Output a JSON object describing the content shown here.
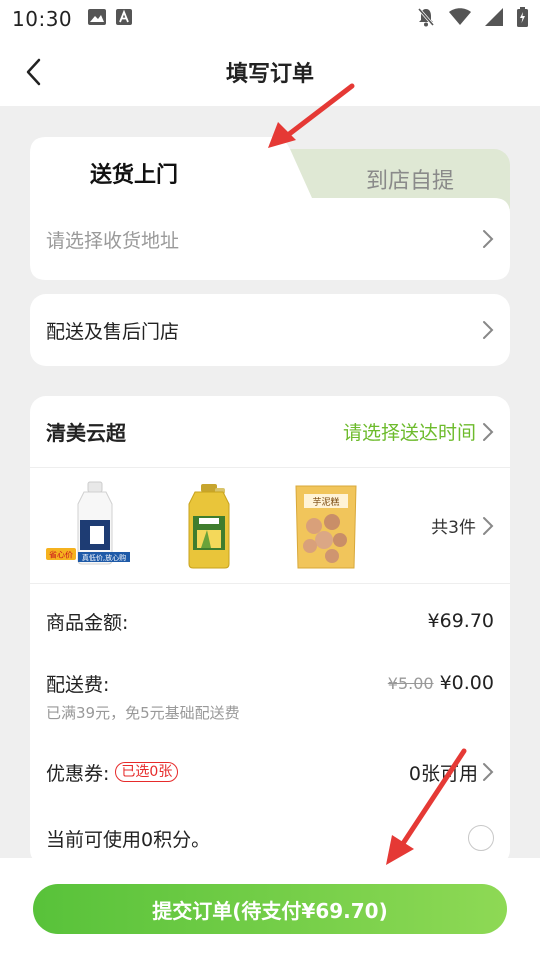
{
  "status_bar": {
    "time": "10:30",
    "left_icons": [
      "image-icon",
      "text-a-icon"
    ],
    "right_icons": [
      "notifications-off-icon",
      "wifi-icon",
      "signal-icon",
      "battery-icon"
    ]
  },
  "header": {
    "title": "填写订单",
    "back_icon": "chevron-left-icon"
  },
  "delivery_tabs": {
    "active": "送货上门",
    "inactive": "到店自提",
    "address_placeholder": "请选择收货地址"
  },
  "store_row": {
    "label": "配送及售后门店"
  },
  "order": {
    "shop_name": "清美云超",
    "select_time": "请选择送达时间",
    "goods_count": "共3件",
    "goods": [
      {
        "name": "milk-bottle",
        "tag_left": "省心价",
        "tag_right": "真低价,放心购"
      },
      {
        "name": "cooking-oil-bottle"
      },
      {
        "name": "snack-bag",
        "label": "芋泥糕"
      }
    ],
    "amount_label": "商品金额:",
    "amount_value": "¥69.70",
    "shipping_label": "配送费:",
    "shipping_old": "¥5.00",
    "shipping_new": "¥0.00",
    "shipping_note": "已满39元，免5元基础配送费",
    "coupon_label": "优惠券:",
    "coupon_badge": "已选0张",
    "coupon_available": "0张可用",
    "points_text": "当前可使用0积分。"
  },
  "submit": {
    "label": "提交订单(待支付¥69.70)"
  },
  "colors": {
    "accent_green": "#6dbb2c",
    "submit_gradient_start": "#58c23a",
    "submit_gradient_end": "#8ed955",
    "coupon_red": "#e62b2b",
    "annotation_red": "#e53935",
    "tab_inactive_bg": "#dfe8d4"
  }
}
